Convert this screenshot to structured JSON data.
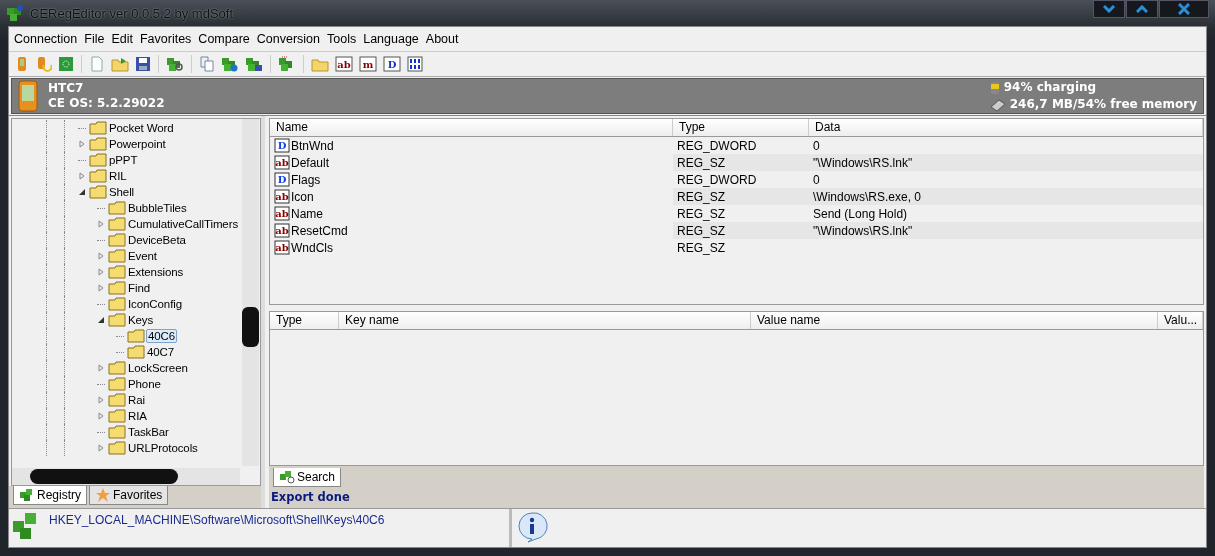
{
  "window": {
    "title": "CERegEditor ver 0.0.5.2 by mdSoft"
  },
  "menu": [
    "Connection",
    "File",
    "Edit",
    "Favorites",
    "Compare",
    "Conversion",
    "Tools",
    "Language",
    "About"
  ],
  "toolbar": [
    {
      "kind": "device"
    },
    {
      "kind": "sync"
    },
    {
      "kind": "dotted-square"
    },
    {
      "kind": "sep"
    },
    {
      "kind": "new"
    },
    {
      "kind": "open"
    },
    {
      "kind": "save"
    },
    {
      "kind": "sep"
    },
    {
      "kind": "cubes-search"
    },
    {
      "kind": "sep"
    },
    {
      "kind": "copy"
    },
    {
      "kind": "cubes-arrow"
    },
    {
      "kind": "cubes-disk"
    },
    {
      "kind": "sep"
    },
    {
      "kind": "cubes-import"
    },
    {
      "kind": "sep"
    },
    {
      "kind": "folder"
    },
    {
      "kind": "letter",
      "glyph": "ab",
      "color": "#8b0000"
    },
    {
      "kind": "letter",
      "glyph": "m",
      "color": "#8b0000"
    },
    {
      "kind": "letter",
      "glyph": "D",
      "color": "#1030d0"
    },
    {
      "kind": "binary"
    }
  ],
  "device": {
    "name": "HTC7",
    "os": "CE OS: 5.2.29022",
    "battery": "94% charging",
    "memory": "246,7 MB/54% free memory"
  },
  "tree": [
    {
      "label": "Pocket Word",
      "selected": false
    },
    {
      "label": "Powerpoint",
      "selected": false,
      "expanded": false
    },
    {
      "label": "pPPT",
      "selected": false
    },
    {
      "label": "RIL",
      "selected": false,
      "expanded": false
    },
    {
      "label": "Shell",
      "selected": false,
      "expanded": true,
      "children": [
        {
          "label": "BubbleTiles",
          "selected": false
        },
        {
          "label": "CumulativeCallTimers",
          "selected": false,
          "expanded": false
        },
        {
          "label": "DeviceBeta",
          "selected": false
        },
        {
          "label": "Event",
          "selected": false,
          "expanded": false
        },
        {
          "label": "Extensions",
          "selected": false,
          "expanded": false
        },
        {
          "label": "Find",
          "selected": false,
          "expanded": false
        },
        {
          "label": "IconConfig",
          "selected": false
        },
        {
          "label": "Keys",
          "selected": false,
          "expanded": true,
          "children": [
            {
              "label": "40C6",
              "selected": true
            },
            {
              "label": "40C7",
              "selected": false
            }
          ]
        },
        {
          "label": "LockScreen",
          "selected": false,
          "expanded": false
        },
        {
          "label": "Phone",
          "selected": false
        },
        {
          "label": "Rai",
          "selected": false,
          "expanded": false
        },
        {
          "label": "RIA",
          "selected": false,
          "expanded": false
        },
        {
          "label": "TaskBar",
          "selected": false
        },
        {
          "label": "URLProtocols",
          "selected": false,
          "expanded": false
        }
      ]
    }
  ],
  "left_tabs": [
    {
      "label": "Registry",
      "selected": true,
      "kind": "registry"
    },
    {
      "label": "Favorites",
      "selected": false,
      "kind": "favorites"
    }
  ],
  "values_table": {
    "columns": [
      "Name",
      "Type",
      "Data"
    ],
    "rows": [
      {
        "kind": "dword",
        "glyph": "D",
        "name": "BtnWnd",
        "type": "REG_DWORD",
        "data": "0"
      },
      {
        "kind": "string",
        "glyph": "ab",
        "name": "Default",
        "type": "REG_SZ",
        "data": "\"\\Windows\\RS.lnk\""
      },
      {
        "kind": "dword",
        "glyph": "D",
        "name": "Flags",
        "type": "REG_DWORD",
        "data": "0"
      },
      {
        "kind": "string",
        "glyph": "ab",
        "name": "Icon",
        "type": "REG_SZ",
        "data": "\\Windows\\RS.exe, 0"
      },
      {
        "kind": "string",
        "glyph": "ab",
        "name": "Name",
        "type": "REG_SZ",
        "data": "Send (Long Hold)"
      },
      {
        "kind": "string",
        "glyph": "ab",
        "name": "ResetCmd",
        "type": "REG_SZ",
        "data": "\"\\Windows\\RS.lnk\""
      },
      {
        "kind": "string",
        "glyph": "ab",
        "name": "WndCls",
        "type": "REG_SZ"
      }
    ]
  },
  "search_table": {
    "columns": [
      "Type",
      "Key name",
      "Value name",
      "Valu..."
    ]
  },
  "bottom_tabs": [
    {
      "label": "Search",
      "selected": true
    }
  ],
  "message": "Export done",
  "status_bar": {
    "path": "HKEY_LOCAL_MACHINE\\Software\\Microsoft\\Shell\\Keys\\40C6"
  }
}
